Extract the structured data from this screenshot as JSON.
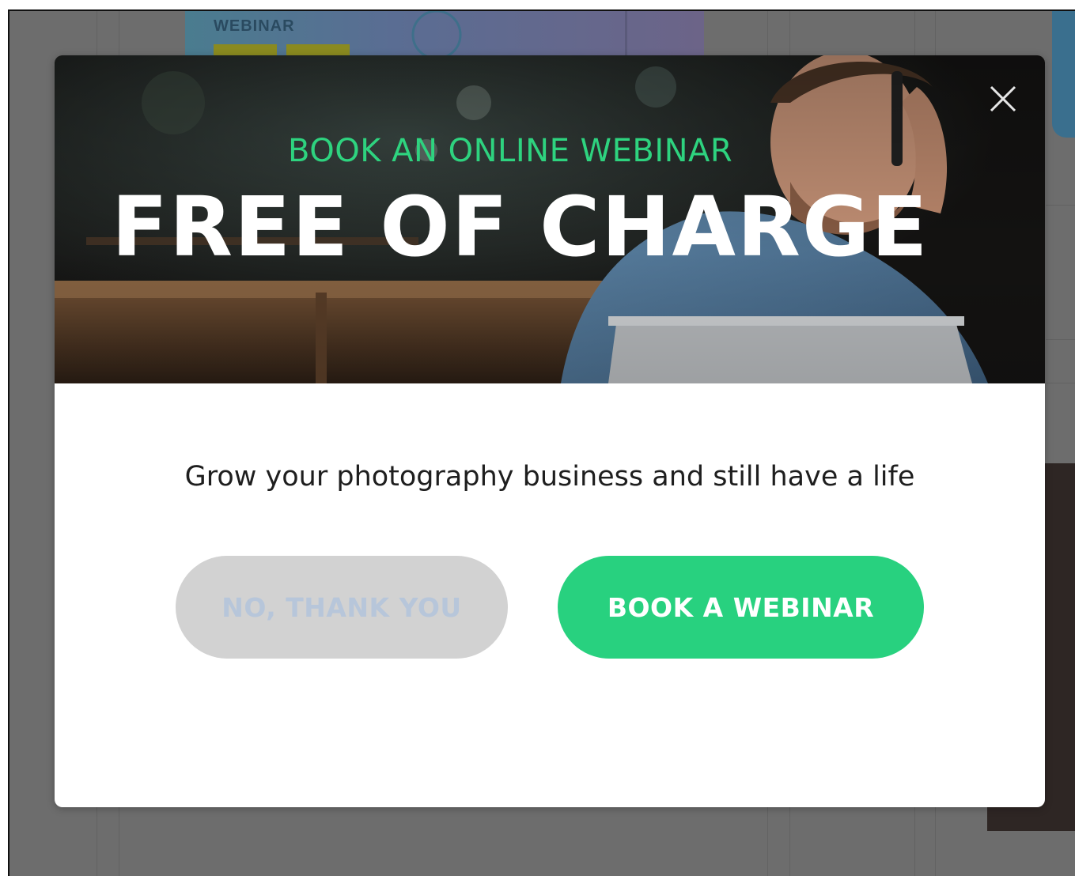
{
  "background": {
    "card_title": "WEBINAR"
  },
  "modal": {
    "kicker": "BOOK AN ONLINE WEBINAR",
    "title": "FREE OF CHARGE",
    "subtitle": "Grow your photography business and still have a life",
    "decline_label": "NO, THANK YOU",
    "accept_label": "BOOK A WEBINAR",
    "close_icon": "close-icon"
  },
  "colors": {
    "accent_green": "#28d17f",
    "kicker_green": "#2ed37f",
    "decline_bg": "#d2d2d2",
    "decline_text": "#b7c6da",
    "overlay": "#6d6d6d"
  }
}
